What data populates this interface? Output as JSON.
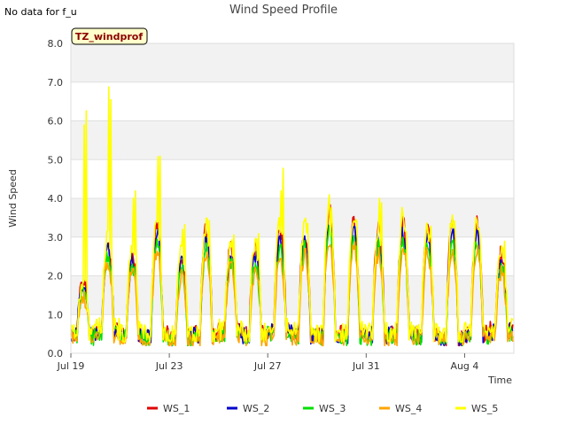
{
  "chart_data": {
    "type": "line",
    "title": "Wind Speed Profile",
    "xlabel": "Time",
    "ylabel": "Wind Speed",
    "ylim": [
      0,
      8
    ],
    "xlim": [
      "2023-07-19",
      "2023-08-06"
    ],
    "yticks": [
      "0.0",
      "1.0",
      "2.0",
      "3.0",
      "4.0",
      "5.0",
      "6.0",
      "7.0",
      "8.0"
    ],
    "xticks": [
      {
        "date": "2023-07-19",
        "label": "Jul 19"
      },
      {
        "date": "2023-07-23",
        "label": "Jul 23"
      },
      {
        "date": "2023-07-27",
        "label": "Jul 27"
      },
      {
        "date": "2023-07-31",
        "label": "Jul 31"
      },
      {
        "date": "2023-08-04",
        "label": "Aug 4"
      }
    ],
    "note": "No data for f_u",
    "badge": "TZ_windprof",
    "grid": true,
    "legend_position": "bottom",
    "series": [
      {
        "name": "WS_1",
        "color": "#e00000"
      },
      {
        "name": "WS_2",
        "color": "#0000cc"
      },
      {
        "name": "WS_3",
        "color": "#00e000"
      },
      {
        "name": "WS_4",
        "color": "#ffa500"
      },
      {
        "name": "WS_5",
        "color": "#ffff00"
      }
    ],
    "daily_profile": [
      {
        "day": "2023-07-19",
        "min": 0.5,
        "max": 1.9,
        "peak5": 6.3
      },
      {
        "day": "2023-07-20",
        "min": 0.6,
        "max": 2.9,
        "peak5": 7.1
      },
      {
        "day": "2023-07-21",
        "min": 0.5,
        "max": 2.6,
        "peak5": 4.4
      },
      {
        "day": "2023-07-22",
        "min": 0.5,
        "max": 3.3,
        "peak5": 5.2
      },
      {
        "day": "2023-07-23",
        "min": 0.4,
        "max": 2.5,
        "peak5": 3.6
      },
      {
        "day": "2023-07-24",
        "min": 0.5,
        "max": 3.2,
        "peak5": 3.5
      },
      {
        "day": "2023-07-25",
        "min": 0.6,
        "max": 2.8,
        "peak5": 3.3
      },
      {
        "day": "2023-07-26",
        "min": 0.5,
        "max": 2.7,
        "peak5": 3.1
      },
      {
        "day": "2023-07-27",
        "min": 0.6,
        "max": 3.2,
        "peak5": 4.8
      },
      {
        "day": "2023-07-28",
        "min": 0.5,
        "max": 3.2,
        "peak5": 3.6
      },
      {
        "day": "2023-07-29",
        "min": 0.5,
        "max": 3.7,
        "peak5": 3.4
      },
      {
        "day": "2023-07-30",
        "min": 0.5,
        "max": 3.4,
        "peak5": 3.5
      },
      {
        "day": "2023-07-31",
        "min": 0.5,
        "max": 3.2,
        "peak5": 4.4
      },
      {
        "day": "2023-08-01",
        "min": 0.5,
        "max": 3.4,
        "peak5": 3.6
      },
      {
        "day": "2023-08-02",
        "min": 0.5,
        "max": 3.3,
        "peak5": 3.3
      },
      {
        "day": "2023-08-03",
        "min": 0.4,
        "max": 3.4,
        "peak5": 3.5
      },
      {
        "day": "2023-08-04",
        "min": 0.5,
        "max": 3.4,
        "peak5": 3.3
      },
      {
        "day": "2023-08-05",
        "min": 0.6,
        "max": 2.6,
        "peak5": 2.9
      }
    ]
  }
}
